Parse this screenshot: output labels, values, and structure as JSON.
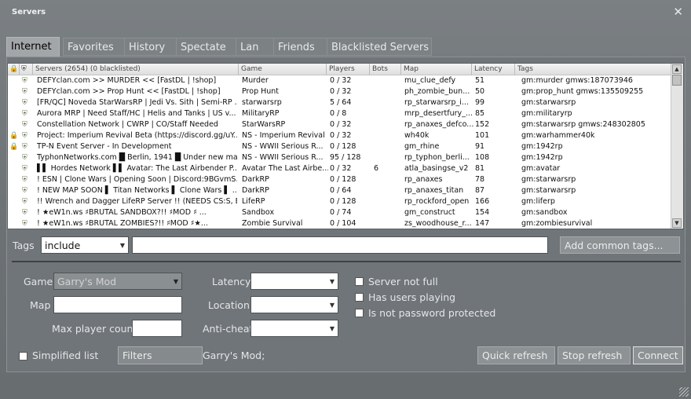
{
  "window": {
    "title": "Servers"
  },
  "tabs": [
    {
      "label": "Internet",
      "active": true
    },
    {
      "label": "Favorites"
    },
    {
      "label": "History"
    },
    {
      "label": "Spectate"
    },
    {
      "label": "Lan"
    },
    {
      "label": "Friends"
    },
    {
      "label": "Blacklisted Servers"
    }
  ],
  "list": {
    "headers": {
      "name": "Servers (2654) (0 blacklisted)",
      "game": "Game",
      "players": "Players",
      "bots": "Bots",
      "map": "Map",
      "latency": "Latency",
      "tags": "Tags"
    },
    "rows": [
      {
        "locked": false,
        "name": "DEFYclan.com >> MURDER << [FastDL | !shop]",
        "game": "Murder",
        "players": "0 / 32",
        "bots": "",
        "map": "mu_clue_defy",
        "latency": "51",
        "tags": "gm:murder gmws:187073946"
      },
      {
        "locked": false,
        "name": "DEFYclan.com >> Prop Hunt << [FastDL | !shop]",
        "game": "Prop Hunt",
        "players": "0 / 32",
        "bots": "",
        "map": "ph_zombie_bun...",
        "latency": "50",
        "tags": "gm:prop_hunt gmws:135509255"
      },
      {
        "locked": false,
        "name": "[FR/QC] Noveda StarWarsRP | Jedi Vs. Sith | Semi-RP ...",
        "game": "starwarsrp",
        "players": "5 / 64",
        "bots": "",
        "map": "rp_starwarsrp_i...",
        "latency": "99",
        "tags": "gm:starwarsrp"
      },
      {
        "locked": false,
        "name": "Aurora MRP | Need Staff/HC | Helis and Tanks | US v...",
        "game": "MilitaryRP",
        "players": "0 / 8",
        "bots": "",
        "map": "mrp_desertfury_...",
        "latency": "85",
        "tags": "gm:militaryrp"
      },
      {
        "locked": false,
        "name": "Constellation Network | CWRP | CO/Staff Needed",
        "game": "StarWarsRP",
        "players": "0 / 32",
        "bots": "",
        "map": "rp_anaxes_defco...",
        "latency": "152",
        "tags": "gm:starwarsrp gmws:248302805"
      },
      {
        "locked": true,
        "name": "Project: Imperium Revival Beta (https://discord.gg/uY...",
        "game": "NS - Imperium Revival",
        "players": "0 / 32",
        "bots": "",
        "map": "wh40k",
        "latency": "101",
        "tags": "gm:warhammer40k"
      },
      {
        "locked": true,
        "name": "TP-N Event Server - In Development",
        "game": "NS - WWII Serious R...",
        "players": "0 / 128",
        "bots": "",
        "map": "gm_rhine",
        "latency": "91",
        "tags": "gm:1942rp"
      },
      {
        "locked": false,
        "name": "TyphonNetworks.com █ Berlin, 1941 █ Under new ma...",
        "game": "NS - WWII Serious R...",
        "players": "95 / 128",
        "bots": "",
        "map": "rp_typhon_berli...",
        "latency": "108",
        "tags": "gm:1942rp"
      },
      {
        "locked": false,
        "name": "▌▌ Hordes Network ▌▌ Avatar: The Last Airbender P...",
        "game": "Avatar The Last Airbe...",
        "players": "0 / 32",
        "bots": "6",
        "map": "atla_basingse_v2",
        "latency": "81",
        "tags": "gm:avatar"
      },
      {
        "locked": false,
        "name": "! ESN | Clone Wars | Opening Soon | Discord:9BGvmS...",
        "game": "DarkRP",
        "players": "0 / 128",
        "bots": "",
        "map": "rp_anaxes",
        "latency": "78",
        "tags": "gm:starwarsrp"
      },
      {
        "locked": false,
        "name": "! NEW MAP SOON ▌ Titan Networks ▌ Clone Wars ▌ ...",
        "game": "DarkRP",
        "players": "0 / 64",
        "bots": "",
        "map": "rp_anaxes_titan",
        "latency": "87",
        "tags": "gm:starwarsrp"
      },
      {
        "locked": false,
        "name": "!! Wrench and Dagger LifeRP Server !! (NEEDS CS:S, E...",
        "game": "LifeRP",
        "players": "0 / 128",
        "bots": "",
        "map": "rp_rockford_open",
        "latency": "166",
        "tags": "gm:liferp"
      },
      {
        "locked": false,
        "name": "!          ★eW1n.ws ♯BRUTAL SANDBOX?!! ♯MOD ♯ ...",
        "game": "Sandbox",
        "players": "0 / 74",
        "bots": "",
        "map": "gm_construct",
        "latency": "154",
        "tags": "gm:sandbox"
      },
      {
        "locked": false,
        "name": "!          ★eW1n.ws ♯BRUTAL ZOMBIES?!! ♯MOD ♯★...",
        "game": "Zombie Survival",
        "players": "0 / 104",
        "bots": "",
        "map": "zs_woodhouse_r...",
        "latency": "147",
        "tags": "gm:zombiesurvival"
      }
    ]
  },
  "tags_row": {
    "label": "Tags",
    "mode": "include",
    "value": "",
    "add_button": "Add common tags..."
  },
  "filters": {
    "game_label": "Game",
    "game_value": "Garry's Mod",
    "map_label": "Map",
    "map_value": "",
    "max_player_label": "Max player count",
    "max_player_value": "",
    "latency_label": "Latency",
    "latency_value": "",
    "location_label": "Location",
    "location_value": "",
    "anticheat_label": "Anti-cheat",
    "anticheat_value": "",
    "not_full_label": "Server not full",
    "users_playing_label": "Has users playing",
    "not_password_label": "Is not password protected"
  },
  "bottom": {
    "simplified_label": "Simplified list",
    "filters_button": "Filters",
    "filter_summary": "Garry's Mod;",
    "quick_refresh": "Quick refresh",
    "stop_refresh": "Stop refresh",
    "connect": "Connect"
  }
}
